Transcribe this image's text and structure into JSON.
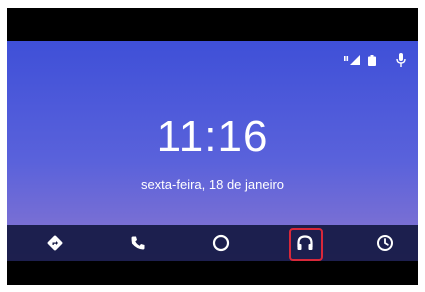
{
  "clock": {
    "time": "11:16"
  },
  "date": {
    "text": "sexta-feira, 18 de janeiro"
  },
  "status_bar": {
    "icons": [
      "signal-icon",
      "battery-icon",
      "microphone-icon"
    ]
  },
  "nav": {
    "items": [
      {
        "name": "navigation-icon"
      },
      {
        "name": "phone-icon"
      },
      {
        "name": "home-icon"
      },
      {
        "name": "headphones-icon",
        "highlighted": true
      },
      {
        "name": "recents-icon"
      }
    ]
  },
  "colors": {
    "screen_top": "#3f50d8",
    "screen_bottom": "#8a76d0",
    "nav_bar": "#141842",
    "highlight": "#d8283a"
  }
}
